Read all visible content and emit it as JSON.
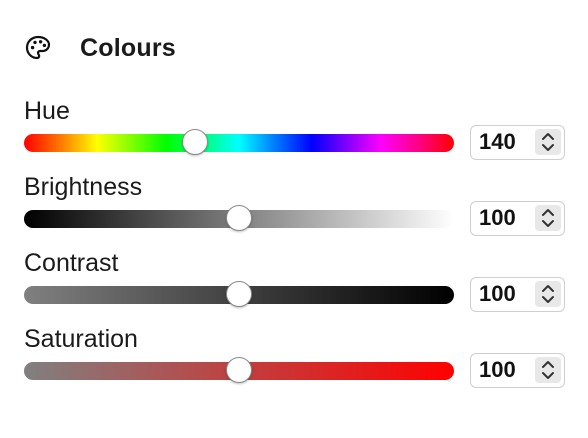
{
  "section": {
    "title": "Colours",
    "icon": "palette-icon"
  },
  "sliders": [
    {
      "label": "Hue",
      "value": "140",
      "fraction": 0.397,
      "track": "linear-gradient(to right, #ff0000 0%, #ff8000 9%, #ffff00 17%, #80ff00 25%, #00ff00 33%, #00ff80 42%, #00ffff 50%, #0080ff 58%, #0000ff 67%, #8000ff 75%, #ff00ff 83%, #ff0080 92%, #ff0000 100%)"
    },
    {
      "label": "Brightness",
      "value": "100",
      "fraction": 0.5,
      "track": "linear-gradient(to right, #000000 0%, #7f7f7f 50%, #ffffff 100%)"
    },
    {
      "label": "Contrast",
      "value": "100",
      "fraction": 0.5,
      "track": "linear-gradient(to right, #808080 0%, #404040 50%, #000000 100%)"
    },
    {
      "label": "Saturation",
      "value": "100",
      "fraction": 0.5,
      "track": "linear-gradient(to right, #808080 0%, #c04040 50%, #ff0000 100%)"
    }
  ]
}
